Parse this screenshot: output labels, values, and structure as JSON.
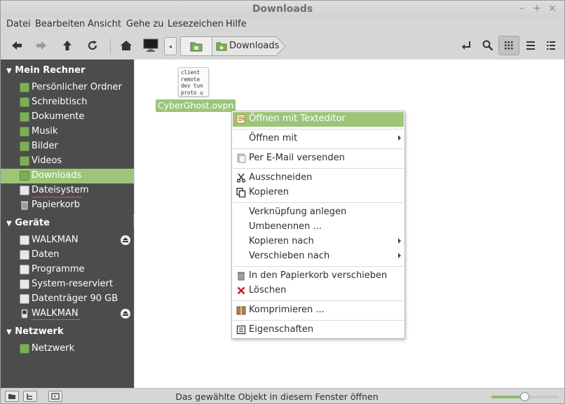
{
  "window": {
    "title": "Downloads"
  },
  "menubar": [
    "Datei",
    "Bearbeiten",
    "Ansicht",
    "Gehe zu",
    "Lesezeichen",
    "Hilfe"
  ],
  "breadcrumb": {
    "current": "Downloads"
  },
  "sidebar": {
    "sections": [
      {
        "title": "Mein Rechner",
        "items": [
          {
            "label": "Persönlicher Ordner",
            "icon": "home-folder-icon"
          },
          {
            "label": "Schreibtisch",
            "icon": "desktop-folder-icon"
          },
          {
            "label": "Dokumente",
            "icon": "documents-folder-icon"
          },
          {
            "label": "Musik",
            "icon": "music-folder-icon"
          },
          {
            "label": "Bilder",
            "icon": "pictures-folder-icon"
          },
          {
            "label": "Videos",
            "icon": "videos-folder-icon"
          },
          {
            "label": "Downloads",
            "icon": "downloads-folder-icon",
            "selected": true
          },
          {
            "label": "Dateisystem",
            "icon": "filesystem-drive-icon"
          },
          {
            "label": "Papierkorb",
            "icon": "trash-icon"
          }
        ]
      },
      {
        "title": "Geräte",
        "items": [
          {
            "label": "WALKMAN",
            "icon": "drive-icon",
            "eject": true
          },
          {
            "label": "Daten",
            "icon": "drive-icon"
          },
          {
            "label": "Programme",
            "icon": "drive-icon"
          },
          {
            "label": "System-reserviert",
            "icon": "drive-icon"
          },
          {
            "label": "Datenträger 90 GB",
            "icon": "drive-icon"
          },
          {
            "label": "WALKMAN",
            "icon": "media-player-icon",
            "eject": true
          }
        ]
      },
      {
        "title": "Netzwerk",
        "items": [
          {
            "label": "Netzwerk",
            "icon": "network-folder-icon"
          }
        ]
      }
    ]
  },
  "file": {
    "name": "CyberGhost.ovpn",
    "preview": "client\nremote\ndev tun\nproto u"
  },
  "context_menu": {
    "items": [
      {
        "label": "Öffnen mit Texteditor",
        "icon": "text-editor-icon",
        "highlighted": true
      },
      {
        "separator": true
      },
      {
        "label": "Öffnen mit",
        "submenu": true
      },
      {
        "separator": true
      },
      {
        "label": "Per E-Mail versenden",
        "icon": "email-icon"
      },
      {
        "separator": true
      },
      {
        "label": "Ausschneiden",
        "icon": "scissors-icon"
      },
      {
        "label": "Kopieren",
        "icon": "copy-icon"
      },
      {
        "separator": true
      },
      {
        "label": "Verknüpfung anlegen"
      },
      {
        "label": "Umbenennen ..."
      },
      {
        "label": "Kopieren nach",
        "submenu": true
      },
      {
        "label": "Verschieben nach",
        "submenu": true
      },
      {
        "separator": true
      },
      {
        "label": "In den Papierkorb verschieben",
        "icon": "trash-icon"
      },
      {
        "label": "Löschen",
        "icon": "delete-x-icon"
      },
      {
        "separator": true
      },
      {
        "label": "Komprimieren ...",
        "icon": "archive-icon"
      },
      {
        "separator": true
      },
      {
        "label": "Eigenschaften",
        "icon": "properties-icon"
      }
    ]
  },
  "status": {
    "text": "Das gewählte Objekt in diesem Fenster öffnen",
    "zoom": 0.5
  },
  "colors": {
    "accent": "#9cc57a",
    "sidebar_bg": "#4c4c4c",
    "delete_red": "#d02020"
  }
}
